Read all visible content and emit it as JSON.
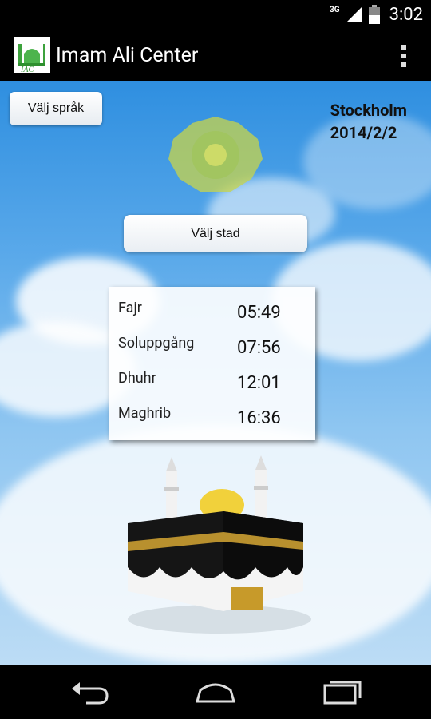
{
  "status_bar": {
    "network": "3G",
    "time": "3:02"
  },
  "action_bar": {
    "title": "Imam Ali Center",
    "logo_text": "IAC"
  },
  "main": {
    "language_button": "Välj språk",
    "city_button": "Välj stad",
    "city_name": "Stockholm",
    "date": "2014/2/2",
    "prayers": [
      {
        "name": "Fajr",
        "time": "05:49"
      },
      {
        "name": "Soluppgång",
        "time": "07:56"
      },
      {
        "name": "Dhuhr",
        "time": "12:01"
      },
      {
        "name": "Maghrib",
        "time": "16:36"
      }
    ]
  },
  "icons": {
    "back": "back-icon",
    "home": "home-icon",
    "recent": "recent-apps-icon",
    "overflow": "overflow-menu-icon"
  }
}
